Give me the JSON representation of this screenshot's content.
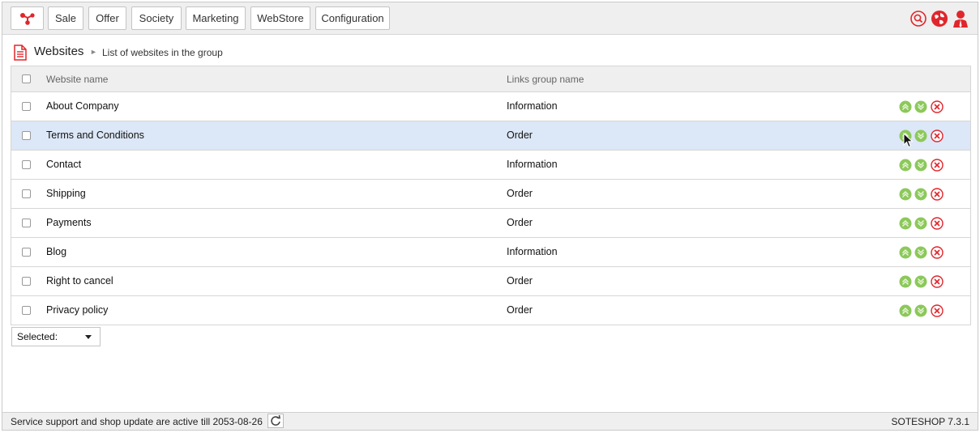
{
  "nav": {
    "logo_icon": "soteshop-logo-icon",
    "items": [
      {
        "label": "Sale"
      },
      {
        "label": "Offer"
      },
      {
        "label": "Society"
      },
      {
        "label": "Marketing"
      },
      {
        "label": "WebStore"
      },
      {
        "label": "Configuration"
      }
    ],
    "right_icons": [
      "search-icon",
      "globe-icon",
      "user-icon"
    ]
  },
  "breadcrumb": {
    "title": "Websites",
    "separator": "►",
    "subtitle": "List of websites in the group"
  },
  "table": {
    "columns": {
      "name": "Website name",
      "group": "Links group name"
    },
    "rows": [
      {
        "name": "About Company",
        "group": "Information"
      },
      {
        "name": "Terms and Conditions",
        "group": "Order"
      },
      {
        "name": "Contact",
        "group": "Information"
      },
      {
        "name": "Shipping",
        "group": "Order"
      },
      {
        "name": "Payments",
        "group": "Order"
      },
      {
        "name": "Blog",
        "group": "Information"
      },
      {
        "name": "Right to cancel",
        "group": "Order"
      },
      {
        "name": "Privacy policy",
        "group": "Order"
      }
    ],
    "highlighted_row": 1
  },
  "bulk_select": {
    "label": "Selected:"
  },
  "footer": {
    "support_text": "Service support and shop update are active till 2053-08-26",
    "version": "SOTESHOP 7.3.1"
  },
  "colors": {
    "accent_red": "#e0262c",
    "action_green": "#8cc85a",
    "row_highlight": "#dce7f7"
  }
}
